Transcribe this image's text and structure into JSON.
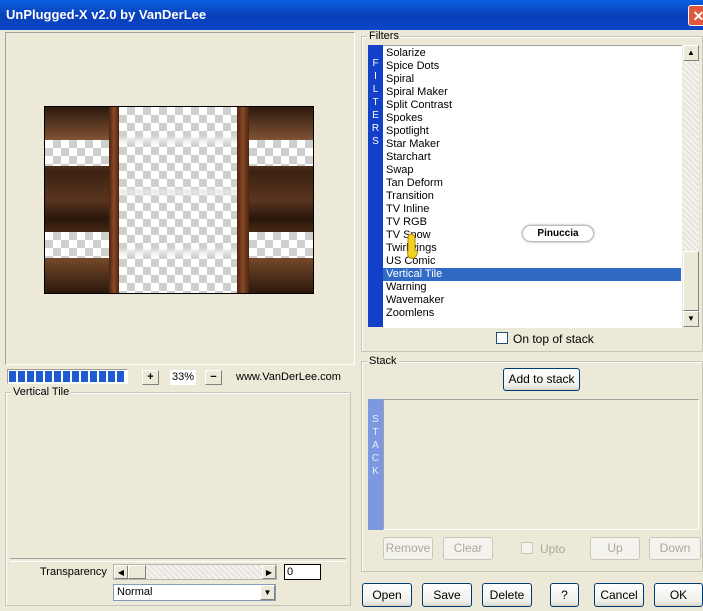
{
  "window": {
    "title": "UnPlugged-X v2.0 by VanDerLee",
    "close_glyph": "✕"
  },
  "preview": {
    "zoom_plus": "+",
    "zoom_value": "33%",
    "zoom_minus": "−",
    "website": "www.VanDerLee.com",
    "progress_segments": 13
  },
  "parameters": {
    "group_label": "Vertical Tile",
    "transparency_label": "Transparency",
    "transparency_value": "0",
    "transparency_slider_fraction": 0.0,
    "blend_mode": "Normal"
  },
  "filters": {
    "group_label": "Filters",
    "side_label": "F\nI\nL\nT\nE\nR\nS",
    "items": [
      "Solarize",
      "Spice Dots",
      "Spiral",
      "Spiral Maker",
      "Split Contrast",
      "Spokes",
      "Spotlight",
      "Star Maker",
      "Starchart",
      "Swap",
      "Tan Deform",
      "Transition",
      "TV Inline",
      "TV RGB",
      "TV Snow",
      "Twirlwings",
      "US Comic",
      "Vertical Tile",
      "Warning",
      "Wavemaker",
      "Zoomlens"
    ],
    "selected": "Vertical Tile",
    "on_top_label": "On top of stack",
    "watermark": "Pinuccia"
  },
  "stack": {
    "group_label": "Stack",
    "side_label": "S\nT\nA\nC\nK",
    "add_button": "Add to stack",
    "remove_button": "Remove",
    "clear_button": "Clear",
    "upto_label": "Upto",
    "up_button": "Up",
    "down_button": "Down"
  },
  "footer": {
    "open": "Open",
    "save": "Save",
    "delete": "Delete",
    "help": "?",
    "cancel": "Cancel",
    "ok": "OK"
  },
  "colors": {
    "title_bar": "#0a4fd0",
    "selection": "#316ac5",
    "filters_bar": "#1240c8",
    "stack_bar": "#7c98e0",
    "progress": "#1e5bd1"
  }
}
